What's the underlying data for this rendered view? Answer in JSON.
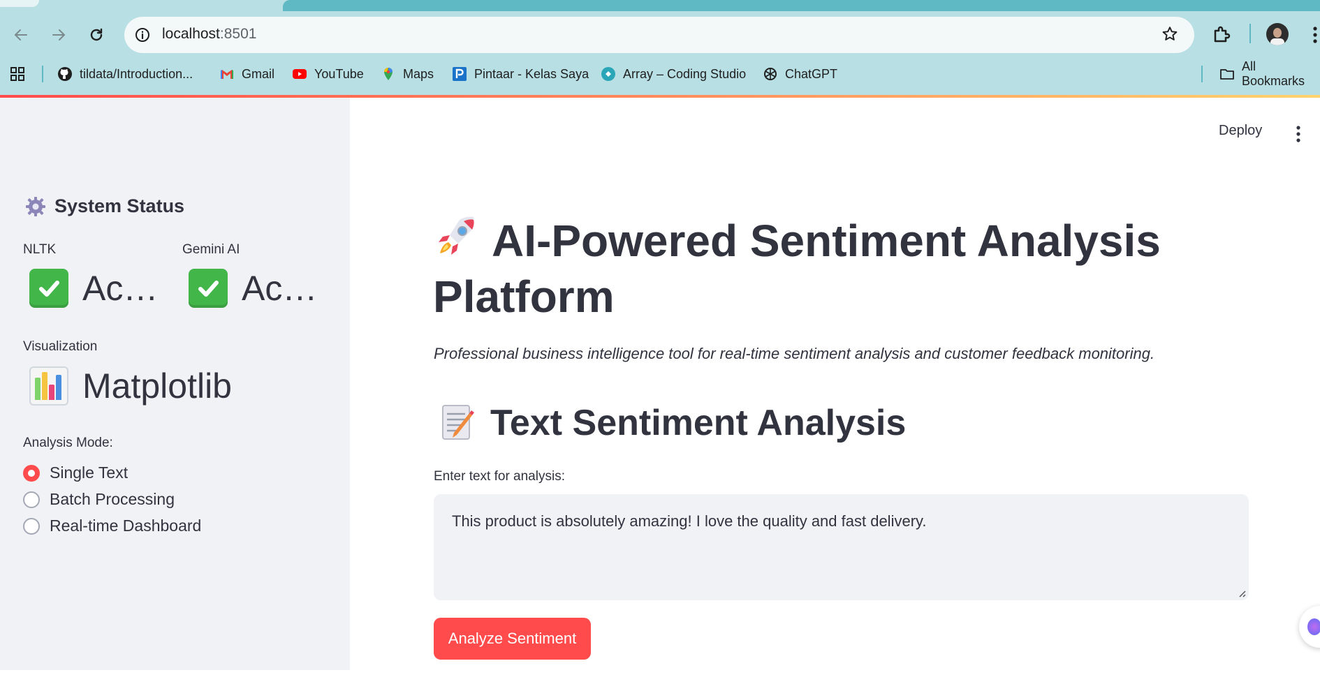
{
  "browser": {
    "url_host": "localhost",
    "url_port": ":8501",
    "bookmarks": [
      {
        "label": "tildata/Introduction...",
        "icon": "github-icon"
      },
      {
        "label": "Gmail",
        "icon": "gmail-icon"
      },
      {
        "label": "YouTube",
        "icon": "youtube-icon"
      },
      {
        "label": "Maps",
        "icon": "maps-icon"
      },
      {
        "label": "Pintaar - Kelas Saya",
        "icon": "pintaar-icon"
      },
      {
        "label": "Array – Coding Studio",
        "icon": "array-icon"
      },
      {
        "label": "ChatGPT",
        "icon": "chatgpt-icon"
      }
    ],
    "all_bookmarks": "All Bookmarks"
  },
  "sidebar": {
    "title": "System Status",
    "title_icon": "gear-icon",
    "metrics": [
      {
        "label": "NLTK",
        "value": "Ac…"
      },
      {
        "label": "Gemini AI",
        "value": "Ac…"
      }
    ],
    "visualization": {
      "label": "Visualization",
      "value": "Matplotlib"
    },
    "mode_label": "Analysis Mode:",
    "modes": [
      "Single Text",
      "Batch Processing",
      "Real-time Dashboard"
    ],
    "selected_mode": "Single Text"
  },
  "header": {
    "deploy": "Deploy"
  },
  "main": {
    "title": "AI-Powered Sentiment Analysis Platform",
    "subtitle": "Professional business intelligence tool for real-time sentiment analysis and customer feedback monitoring.",
    "section_title": "Text Sentiment Analysis",
    "input_label": "Enter text for analysis:",
    "input_value": "This product is absolutely amazing! I love the quality and fast delivery.",
    "button_label": "Analyze Sentiment"
  },
  "colors": {
    "accent": "#ff4b4b",
    "sidebar_bg": "#f0f2f6",
    "chrome_bg": "#b7dfe4",
    "text": "#31333f"
  }
}
